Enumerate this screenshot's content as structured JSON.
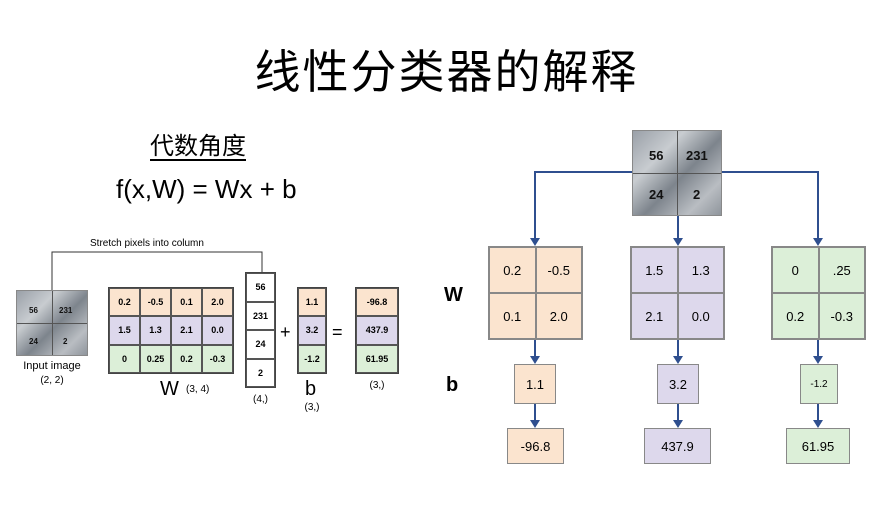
{
  "title": "线性分类器的解释",
  "subtitle": "代数角度",
  "formula": "f(x,W) = Wx + b",
  "stretch_label": "Stretch pixels into column",
  "input_image": {
    "pixels": [
      "56",
      "231",
      "24",
      "2"
    ],
    "label": "Input image",
    "shape": "(2, 2)"
  },
  "W_matrix": {
    "rows": [
      [
        "0.2",
        "-0.5",
        "0.1",
        "2.0"
      ],
      [
        "1.5",
        "1.3",
        "2.1",
        "0.0"
      ],
      [
        "0",
        "0.25",
        "0.2",
        "-0.3"
      ]
    ],
    "label": "W",
    "shape": "(3, 4)"
  },
  "x_vector": {
    "values": [
      "56",
      "231",
      "24",
      "2"
    ],
    "shape": "(4,)"
  },
  "plus": "+",
  "equals": "=",
  "b_vector": {
    "values": [
      "1.1",
      "3.2",
      "-1.2"
    ],
    "label": "b",
    "shape": "(3,)"
  },
  "result_vector": {
    "values": [
      "-96.8",
      "437.9",
      "61.95"
    ],
    "shape": "(3,)"
  },
  "right": {
    "image_pixels": [
      "56",
      "231",
      "24",
      "2"
    ],
    "row_label_w": "W",
    "row_label_b": "b",
    "blocks": [
      {
        "color": "#fbe4cf",
        "w": [
          "0.2",
          "-0.5",
          "0.1",
          "2.0"
        ],
        "b": "1.1",
        "out": "-96.8"
      },
      {
        "color": "#ddd8ec",
        "w": [
          "1.5",
          "1.3",
          "2.1",
          "0.0"
        ],
        "b": "3.2",
        "out": "437.9"
      },
      {
        "color": "#dcefd8",
        "w": [
          "0",
          ".25",
          "0.2",
          "-0.3"
        ],
        "b": "-1.2",
        "out": "61.95"
      }
    ]
  },
  "colors": {
    "arrow": "#2f4f8f",
    "line": "#2f4f8f",
    "orange": "#fbe4cf",
    "purple": "#ddd8ec",
    "green": "#dcefd8"
  }
}
